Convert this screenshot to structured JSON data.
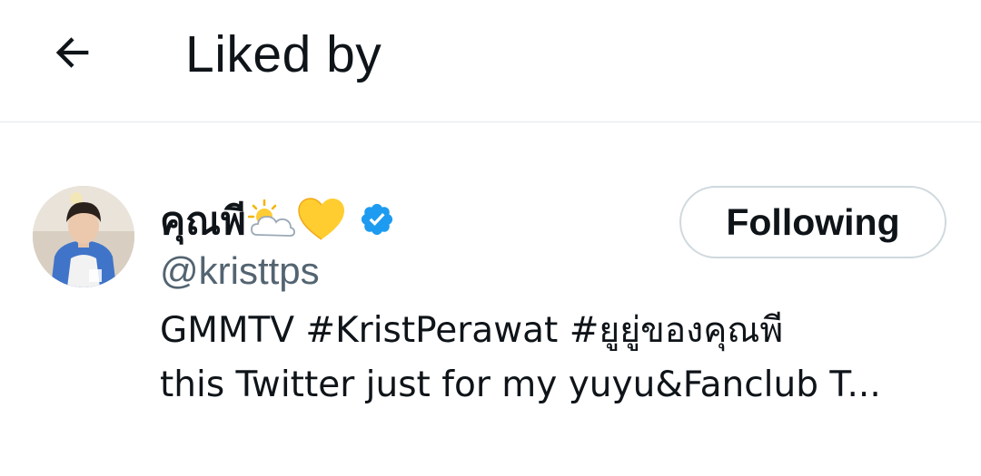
{
  "header": {
    "title": "Liked by",
    "back_icon": "arrow-left-icon"
  },
  "user": {
    "display_name": "คุณพี",
    "emojis": [
      "sun-behind-cloud-icon",
      "yellow-heart-icon"
    ],
    "verified": true,
    "verified_color": "#1d9bf0",
    "handle": "@kristtps",
    "follow_label": "Following",
    "bio_line1": "GMMTV #KristPerawat #ยูยู่ของคุณพี",
    "bio_line2": "this Twitter just for my yuyu&Fanclub T..."
  }
}
